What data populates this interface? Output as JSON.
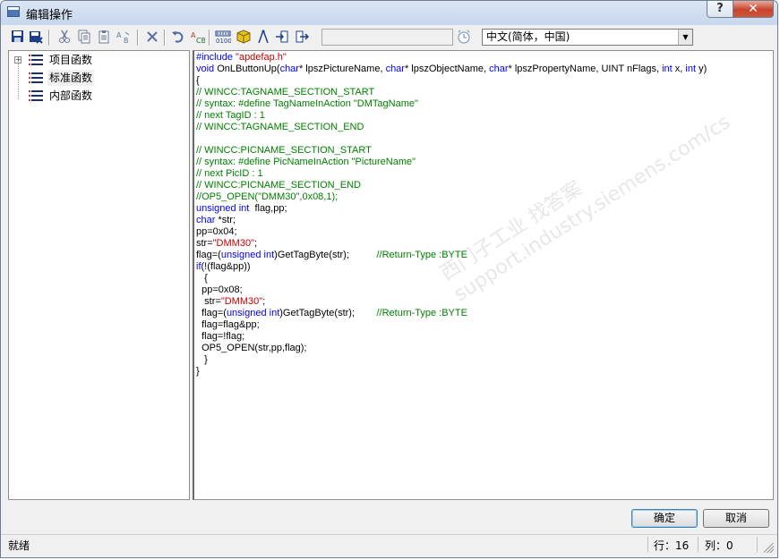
{
  "window": {
    "title": "编辑操作",
    "help_label": "?",
    "close_label": "✕"
  },
  "toolbar": {
    "icons": [
      "save-icon",
      "save-as-icon",
      "cut-icon",
      "copy-icon",
      "paste-icon",
      "replace-icon",
      "delete-icon",
      "undo-icon",
      "spell-check-icon",
      "compile-icon",
      "cube-icon",
      "compass-icon",
      "import-icon",
      "export-icon",
      "clock-icon"
    ],
    "language": "中文(简体，中国)"
  },
  "tree": {
    "items": [
      {
        "label": "项目函数",
        "expandable": true,
        "selected": false
      },
      {
        "label": "标准函数",
        "expandable": false,
        "selected": true
      },
      {
        "label": "内部函数",
        "expandable": false,
        "selected": false
      }
    ]
  },
  "code": {
    "lines": [
      [
        {
          "t": "#include ",
          "c": "pp"
        },
        {
          "t": "\"apdefap.h\"",
          "c": "st"
        }
      ],
      [
        {
          "t": "void",
          "c": "kw"
        },
        {
          "t": " OnLButtonUp(",
          "c": ""
        },
        {
          "t": "char",
          "c": "kw"
        },
        {
          "t": "* lpszPictureName, ",
          "c": ""
        },
        {
          "t": "char",
          "c": "kw"
        },
        {
          "t": "* lpszObjectName, ",
          "c": ""
        },
        {
          "t": "char",
          "c": "kw"
        },
        {
          "t": "* lpszPropertyName, UINT nFlags, ",
          "c": ""
        },
        {
          "t": "int",
          "c": "kw"
        },
        {
          "t": " x, ",
          "c": ""
        },
        {
          "t": "int",
          "c": "kw"
        },
        {
          "t": " y)",
          "c": ""
        }
      ],
      [
        {
          "t": "{",
          "c": ""
        }
      ],
      [
        {
          "t": "// WINCC:TAGNAME_SECTION_START",
          "c": "cm"
        }
      ],
      [
        {
          "t": "// syntax: #define TagNameInAction \"DMTagName\"",
          "c": "cm"
        }
      ],
      [
        {
          "t": "// next TagID : 1",
          "c": "cm"
        }
      ],
      [
        {
          "t": "// WINCC:TAGNAME_SECTION_END",
          "c": "cm"
        }
      ],
      [
        {
          "t": "",
          "c": ""
        }
      ],
      [
        {
          "t": "// WINCC:PICNAME_SECTION_START",
          "c": "cm"
        }
      ],
      [
        {
          "t": "// syntax: #define PicNameInAction \"PictureName\"",
          "c": "cm"
        }
      ],
      [
        {
          "t": "// next PicID : 1",
          "c": "cm"
        }
      ],
      [
        {
          "t": "// WINCC:PICNAME_SECTION_END",
          "c": "cm"
        }
      ],
      [
        {
          "t": "//OP5_OPEN(\"DMM30\",0x08,1);",
          "c": "cm"
        }
      ],
      [
        {
          "t": "unsigned int",
          "c": "kw"
        },
        {
          "t": "  flag,pp;",
          "c": ""
        }
      ],
      [
        {
          "t": "char",
          "c": "kw"
        },
        {
          "t": " *str;",
          "c": ""
        }
      ],
      [
        {
          "t": "pp=0x04;",
          "c": ""
        }
      ],
      [
        {
          "t": "str=",
          "c": ""
        },
        {
          "t": "\"DMM30\"",
          "c": "st"
        },
        {
          "t": ";",
          "c": ""
        }
      ],
      [
        {
          "t": "flag=(",
          "c": ""
        },
        {
          "t": "unsigned int",
          "c": "kw"
        },
        {
          "t": ")GetTagByte(str);          ",
          "c": ""
        },
        {
          "t": "//Return-Type :BYTE",
          "c": "cm"
        }
      ],
      [
        {
          "t": "if",
          "c": "kw"
        },
        {
          "t": "(!(flag&pp))",
          "c": ""
        }
      ],
      [
        {
          "t": "   {",
          "c": ""
        }
      ],
      [
        {
          "t": "  pp=0x08;",
          "c": ""
        }
      ],
      [
        {
          "t": "   str=",
          "c": ""
        },
        {
          "t": "\"DMM30\"",
          "c": "st"
        },
        {
          "t": ";",
          "c": ""
        }
      ],
      [
        {
          "t": "  flag=(",
          "c": ""
        },
        {
          "t": "unsigned int",
          "c": "kw"
        },
        {
          "t": ")GetTagByte(str);        ",
          "c": ""
        },
        {
          "t": "//Return-Type :BYTE",
          "c": "cm"
        }
      ],
      [
        {
          "t": "  flag=flag&pp;",
          "c": ""
        }
      ],
      [
        {
          "t": "  flag=!flag;",
          "c": ""
        }
      ],
      [
        {
          "t": "  OP5_OPEN(str,pp,flag);",
          "c": ""
        }
      ],
      [
        {
          "t": "   }",
          "c": ""
        }
      ],
      [
        {
          "t": "}",
          "c": ""
        }
      ]
    ]
  },
  "watermark": {
    "line1": "西门子工业 找答案",
    "line2": "support.industry.siemens.com/cs"
  },
  "buttons": {
    "ok": "确定",
    "cancel": "取消"
  },
  "status": {
    "text": "就绪",
    "row": "行：16",
    "col": "列：0"
  },
  "colors": {
    "keyword": "#0000ff",
    "comment": "#008000",
    "string": "#c00000",
    "close_button": "#c7442c"
  }
}
